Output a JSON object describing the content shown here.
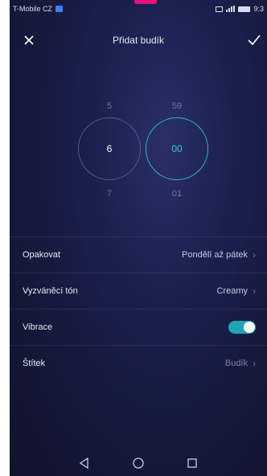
{
  "status_bar": {
    "carrier": "T-Mobile CZ",
    "time": "9:3"
  },
  "header": {
    "title": "Přidat budík",
    "close_icon": "close-icon",
    "confirm_icon": "check-icon"
  },
  "picker": {
    "hour_prev": "5",
    "hour_selected": "6",
    "hour_next": "7",
    "minute_prev": "59",
    "minute_selected": "00",
    "minute_next": "01"
  },
  "settings": {
    "repeat_label": "Opakovat",
    "repeat_value": "Pondělí až pátek",
    "ringtone_label": "Vyzváněcí tón",
    "ringtone_value": "Creamy",
    "vibration_label": "Vibrace",
    "vibration_on": true,
    "tag_label": "Štítek",
    "tag_value": "Budík"
  },
  "colors": {
    "accent": "#2bb8c4",
    "brand": "#e3137b",
    "background": "#1a1f4e"
  }
}
